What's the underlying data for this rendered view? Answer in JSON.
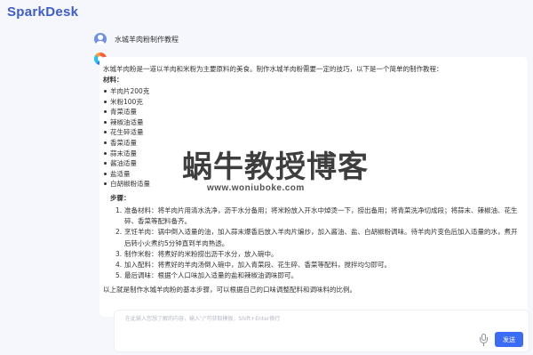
{
  "app": {
    "brand": "SparkDesk"
  },
  "conversation": {
    "question": "水城羊肉粉制作教程",
    "answer": {
      "intro": "水城羊肉粉是一道以羊肉和米粉为主要原料的美食。制作水城羊肉粉需要一定的技巧，以下是一个简单的制作教程：",
      "ingredients_title": "材料：",
      "ingredients": [
        "羊肉片200克",
        "米粉100克",
        "青菜适量",
        "辣椒油适量",
        "花生碎适量",
        "香菜适量",
        "蒜末适量",
        "酱油适量",
        "盐适量",
        "白胡椒粉适量"
      ],
      "steps_title": "步骤：",
      "steps": [
        {
          "num": "1.",
          "text": "准备材料：将羊肉片用清水洗净，沥干水分备用；将米粉放入开水中焯烫一下，捞出备用；将青菜洗净切成段；将蒜末、辣椒油、花生碎、香菜等配料备齐。"
        },
        {
          "num": "2.",
          "text": "烹饪羊肉：锅中倒入适量的油，加入蒜末爆香后放入羊肉片煸炒，加入酱油、盐、白胡椒粉调味。待羊肉片变色后加入适量的水，煮开后转小火煮约5分钟直到羊肉熟透。"
        },
        {
          "num": "3.",
          "text": "制作米粉：将煮好的米粉捞出沥干水分，放入碗中。"
        },
        {
          "num": "4.",
          "text": "加入配料：将煮好的羊肉汤倒入碗中，加入青菜段、花生碎、香菜等配料，搅拌均匀即可。"
        },
        {
          "num": "5.",
          "text": "最后调味：根据个人口味加入适量的盐和辣椒油调味即可。"
        }
      ],
      "outro": "以上就是制作水城羊肉粉的基本步骤，可以根据自己的口味调整配料和调味料的比例。"
    }
  },
  "watermark": {
    "name": "蜗牛教授博客",
    "url": "www.woniuboke.com"
  },
  "composer": {
    "placeholder": "在此输入您想了解的内容，输入\"/\"可获取模板，Shift+Enter换行",
    "send_label": "发送"
  },
  "icons": {
    "user_avatar": "user-avatar-icon",
    "bot_avatar": "spark-logo-icon",
    "mic": "microphone-icon"
  },
  "colors": {
    "brand": "#3c5ccf",
    "accent": "#3b6cf6",
    "background": "#f5f7fc"
  }
}
